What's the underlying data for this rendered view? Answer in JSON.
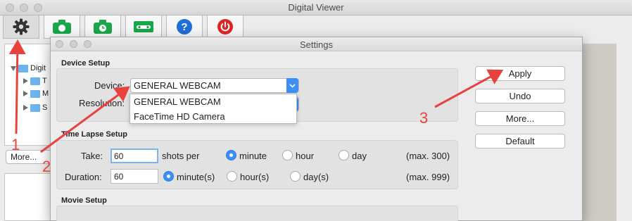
{
  "window": {
    "title": "Digital Viewer"
  },
  "toolbar": {
    "buttons": [
      {
        "icon": "gear-icon",
        "color": "#333333"
      },
      {
        "icon": "camera-icon",
        "color": "#1aa64a"
      },
      {
        "icon": "timelapse-camera-icon",
        "color": "#1aa64a"
      },
      {
        "icon": "video-camera-icon",
        "color": "#1aa64a"
      },
      {
        "icon": "help-icon",
        "color": "#1f6fd6"
      },
      {
        "icon": "power-icon",
        "color": "#e02424"
      }
    ]
  },
  "left_panel": {
    "tree": [
      {
        "label": "Digit",
        "expanded": true
      },
      {
        "label": "T",
        "expanded": false
      },
      {
        "label": "M",
        "expanded": false
      },
      {
        "label": "S",
        "expanded": false
      }
    ],
    "more_label": "More..."
  },
  "dialog": {
    "title": "Settings",
    "device_setup": {
      "heading": "Device Setup",
      "device_label": "Device:",
      "device_value": "GENERAL WEBCAM",
      "resolution_label": "Resolution:",
      "options": [
        "GENERAL WEBCAM",
        "FaceTime HD Camera"
      ]
    },
    "time_lapse": {
      "heading": "Time Lapse Setup",
      "take_label": "Take:",
      "take_value": "60",
      "shots_per_label": "shots per",
      "take_units": [
        "minute",
        "hour",
        "day"
      ],
      "take_selected": "minute",
      "take_max": "(max. 300)",
      "duration_label": "Duration:",
      "duration_value": "60",
      "duration_units": [
        "minute(s)",
        "hour(s)",
        "day(s)"
      ],
      "duration_selected": "minute(s)",
      "duration_max": "(max. 999)"
    },
    "movie_setup": {
      "heading": "Movie Setup"
    },
    "buttons": {
      "apply": "Apply",
      "undo": "Undo",
      "more": "More...",
      "default": "Default"
    }
  },
  "annotations": {
    "step1": "1",
    "step2": "2",
    "step3": "3",
    "color": "#e8423f"
  }
}
